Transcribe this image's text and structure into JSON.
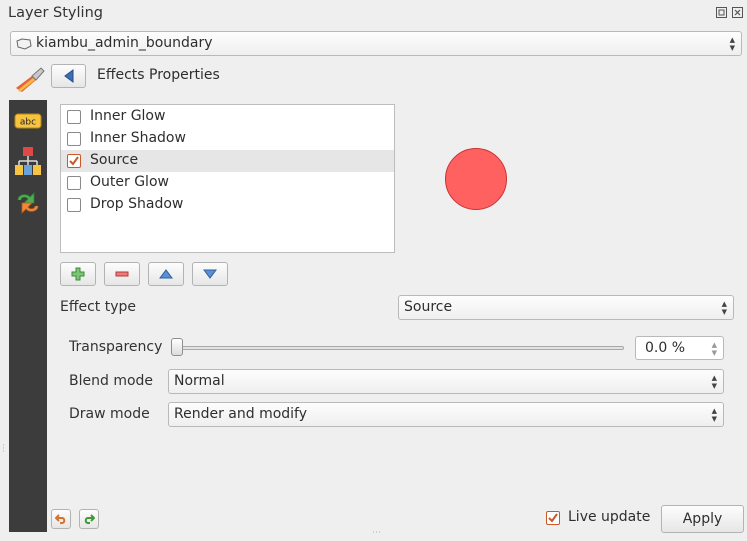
{
  "window": {
    "title": "Layer Styling",
    "float_icon": "float-icon",
    "close_icon": "close-icon"
  },
  "layer_selector": {
    "value": "kiambu_admin_boundary",
    "icon": "polygon-layer-icon"
  },
  "header": {
    "title": "Effects Properties",
    "back_icon": "back-arrow-icon"
  },
  "sidebar": {
    "items": [
      {
        "name": "labels",
        "icon": "abc-label-icon"
      },
      {
        "name": "diagrams",
        "icon": "diagram-icon"
      },
      {
        "name": "history",
        "icon": "history-icon"
      }
    ]
  },
  "effects": {
    "items": [
      {
        "label": "Inner Glow",
        "checked": false,
        "selected": false
      },
      {
        "label": "Inner Shadow",
        "checked": false,
        "selected": false
      },
      {
        "label": "Source",
        "checked": true,
        "selected": true
      },
      {
        "label": "Outer Glow",
        "checked": false,
        "selected": false
      },
      {
        "label": "Drop Shadow",
        "checked": false,
        "selected": false
      }
    ],
    "buttons": [
      "add-effect-icon",
      "remove-effect-icon",
      "move-up-icon",
      "move-down-icon"
    ]
  },
  "preview": {
    "fill": "#ff6161",
    "stroke": "#c93232"
  },
  "form": {
    "effect_type_label": "Effect type",
    "effect_type_value": "Source",
    "transparency_label": "Transparency",
    "transparency_value": "0.0 %",
    "transparency_level": 0,
    "blend_mode_label": "Blend mode",
    "blend_mode_value": "Normal",
    "draw_mode_label": "Draw mode",
    "draw_mode_value": "Render and modify"
  },
  "footer": {
    "undo_icon": "undo-icon",
    "redo_icon": "redo-icon",
    "live_update_label": "Live update",
    "live_update_checked": true,
    "apply_label": "Apply"
  },
  "colors": {
    "accent": "#c9582a",
    "sidebar_bg": "#3c3c3c",
    "selection_bg": "#e6e6e6"
  }
}
